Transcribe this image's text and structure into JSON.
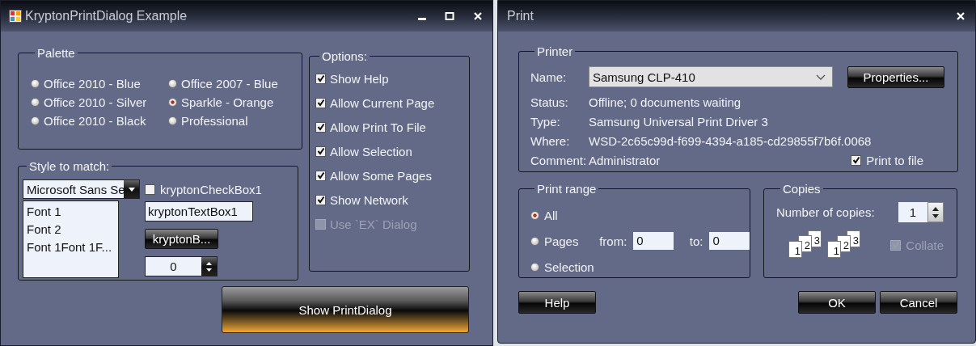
{
  "main_window": {
    "title": "KryptonPrintDialog Example",
    "palette": {
      "title": "Palette",
      "options": [
        {
          "label": "Office 2010 - Blue",
          "selected": false
        },
        {
          "label": "Office 2007 - Blue",
          "selected": false
        },
        {
          "label": "Office 2010 - Silver",
          "selected": false
        },
        {
          "label": "Sparkle - Orange",
          "selected": true
        },
        {
          "label": "Office 2010 - Black",
          "selected": false
        },
        {
          "label": "Professional",
          "selected": false
        }
      ]
    },
    "style_to_match": {
      "title": "Style to match:",
      "font_combo": {
        "value": "Microsoft Sans Se"
      },
      "font_list": {
        "items": [
          "Font 1",
          "Font 2",
          "Font 1Font 1F..."
        ]
      },
      "checkbox": {
        "label": "kryptonCheckBox1",
        "checked": false
      },
      "textbox": {
        "value": "kryptonTextBox1"
      },
      "button": {
        "label": "kryptonB..."
      },
      "spinner": {
        "value": "0"
      }
    },
    "options": {
      "title": "Options:",
      "items": [
        {
          "label": "Show Help",
          "checked": true,
          "disabled": false
        },
        {
          "label": "Allow Current Page",
          "checked": true,
          "disabled": false
        },
        {
          "label": "Allow Print To File",
          "checked": true,
          "disabled": false
        },
        {
          "label": "Allow Selection",
          "checked": true,
          "disabled": false
        },
        {
          "label": "Allow Some Pages",
          "checked": true,
          "disabled": false
        },
        {
          "label": "Show Network",
          "checked": true,
          "disabled": false
        },
        {
          "label": "Use `EX` Dialog",
          "checked": false,
          "disabled": true
        }
      ]
    },
    "show_button": {
      "label": "Show PrintDialog"
    }
  },
  "print_dialog": {
    "title": "Print",
    "printer": {
      "title": "Printer",
      "name_label": "Name:",
      "name_value": "Samsung CLP-410",
      "properties_button": "Properties...",
      "info": [
        {
          "label": "Status:",
          "value": "Offline; 0 documents waiting"
        },
        {
          "label": "Type:",
          "value": "Samsung Universal Print Driver 3"
        },
        {
          "label": "Where:",
          "value": "WSD-2c65c99d-f699-4394-a185-cd29855f7b6f.0068"
        },
        {
          "label": "Comment:",
          "value": "Administrator"
        }
      ],
      "print_to_file": {
        "label": "Print to file",
        "checked": true
      }
    },
    "print_range": {
      "title": "Print range",
      "options": [
        {
          "label": "All",
          "selected": true
        },
        {
          "label": "Pages",
          "selected": false
        },
        {
          "label": "Selection",
          "selected": false
        }
      ],
      "from_label": "from:",
      "from_value": "0",
      "to_label": "to:",
      "to_value": "0"
    },
    "copies": {
      "title": "Copies",
      "count_label": "Number of copies:",
      "count_value": "1",
      "collate_sets": [
        [
          "1",
          "2",
          "3"
        ],
        [
          "1",
          "2",
          "3"
        ]
      ],
      "collate": {
        "label": "Collate",
        "checked": true,
        "disabled": true
      }
    },
    "buttons": [
      {
        "label": "Help"
      },
      {
        "label": "OK"
      },
      {
        "label": "Cancel"
      }
    ]
  }
}
